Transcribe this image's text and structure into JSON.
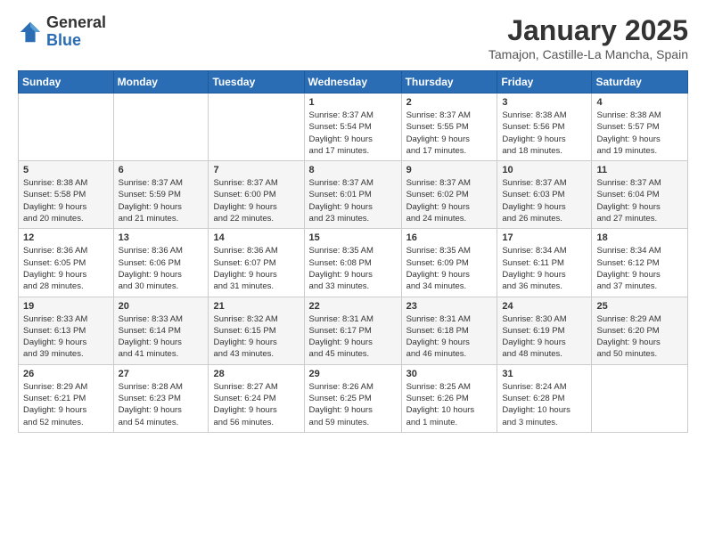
{
  "logo": {
    "general": "General",
    "blue": "Blue"
  },
  "header": {
    "month": "January 2025",
    "location": "Tamajon, Castille-La Mancha, Spain"
  },
  "weekdays": [
    "Sunday",
    "Monday",
    "Tuesday",
    "Wednesday",
    "Thursday",
    "Friday",
    "Saturday"
  ],
  "weeks": [
    [
      {
        "day": "",
        "info": ""
      },
      {
        "day": "",
        "info": ""
      },
      {
        "day": "",
        "info": ""
      },
      {
        "day": "1",
        "info": "Sunrise: 8:37 AM\nSunset: 5:54 PM\nDaylight: 9 hours\nand 17 minutes."
      },
      {
        "day": "2",
        "info": "Sunrise: 8:37 AM\nSunset: 5:55 PM\nDaylight: 9 hours\nand 17 minutes."
      },
      {
        "day": "3",
        "info": "Sunrise: 8:38 AM\nSunset: 5:56 PM\nDaylight: 9 hours\nand 18 minutes."
      },
      {
        "day": "4",
        "info": "Sunrise: 8:38 AM\nSunset: 5:57 PM\nDaylight: 9 hours\nand 19 minutes."
      }
    ],
    [
      {
        "day": "5",
        "info": "Sunrise: 8:38 AM\nSunset: 5:58 PM\nDaylight: 9 hours\nand 20 minutes."
      },
      {
        "day": "6",
        "info": "Sunrise: 8:37 AM\nSunset: 5:59 PM\nDaylight: 9 hours\nand 21 minutes."
      },
      {
        "day": "7",
        "info": "Sunrise: 8:37 AM\nSunset: 6:00 PM\nDaylight: 9 hours\nand 22 minutes."
      },
      {
        "day": "8",
        "info": "Sunrise: 8:37 AM\nSunset: 6:01 PM\nDaylight: 9 hours\nand 23 minutes."
      },
      {
        "day": "9",
        "info": "Sunrise: 8:37 AM\nSunset: 6:02 PM\nDaylight: 9 hours\nand 24 minutes."
      },
      {
        "day": "10",
        "info": "Sunrise: 8:37 AM\nSunset: 6:03 PM\nDaylight: 9 hours\nand 26 minutes."
      },
      {
        "day": "11",
        "info": "Sunrise: 8:37 AM\nSunset: 6:04 PM\nDaylight: 9 hours\nand 27 minutes."
      }
    ],
    [
      {
        "day": "12",
        "info": "Sunrise: 8:36 AM\nSunset: 6:05 PM\nDaylight: 9 hours\nand 28 minutes."
      },
      {
        "day": "13",
        "info": "Sunrise: 8:36 AM\nSunset: 6:06 PM\nDaylight: 9 hours\nand 30 minutes."
      },
      {
        "day": "14",
        "info": "Sunrise: 8:36 AM\nSunset: 6:07 PM\nDaylight: 9 hours\nand 31 minutes."
      },
      {
        "day": "15",
        "info": "Sunrise: 8:35 AM\nSunset: 6:08 PM\nDaylight: 9 hours\nand 33 minutes."
      },
      {
        "day": "16",
        "info": "Sunrise: 8:35 AM\nSunset: 6:09 PM\nDaylight: 9 hours\nand 34 minutes."
      },
      {
        "day": "17",
        "info": "Sunrise: 8:34 AM\nSunset: 6:11 PM\nDaylight: 9 hours\nand 36 minutes."
      },
      {
        "day": "18",
        "info": "Sunrise: 8:34 AM\nSunset: 6:12 PM\nDaylight: 9 hours\nand 37 minutes."
      }
    ],
    [
      {
        "day": "19",
        "info": "Sunrise: 8:33 AM\nSunset: 6:13 PM\nDaylight: 9 hours\nand 39 minutes."
      },
      {
        "day": "20",
        "info": "Sunrise: 8:33 AM\nSunset: 6:14 PM\nDaylight: 9 hours\nand 41 minutes."
      },
      {
        "day": "21",
        "info": "Sunrise: 8:32 AM\nSunset: 6:15 PM\nDaylight: 9 hours\nand 43 minutes."
      },
      {
        "day": "22",
        "info": "Sunrise: 8:31 AM\nSunset: 6:17 PM\nDaylight: 9 hours\nand 45 minutes."
      },
      {
        "day": "23",
        "info": "Sunrise: 8:31 AM\nSunset: 6:18 PM\nDaylight: 9 hours\nand 46 minutes."
      },
      {
        "day": "24",
        "info": "Sunrise: 8:30 AM\nSunset: 6:19 PM\nDaylight: 9 hours\nand 48 minutes."
      },
      {
        "day": "25",
        "info": "Sunrise: 8:29 AM\nSunset: 6:20 PM\nDaylight: 9 hours\nand 50 minutes."
      }
    ],
    [
      {
        "day": "26",
        "info": "Sunrise: 8:29 AM\nSunset: 6:21 PM\nDaylight: 9 hours\nand 52 minutes."
      },
      {
        "day": "27",
        "info": "Sunrise: 8:28 AM\nSunset: 6:23 PM\nDaylight: 9 hours\nand 54 minutes."
      },
      {
        "day": "28",
        "info": "Sunrise: 8:27 AM\nSunset: 6:24 PM\nDaylight: 9 hours\nand 56 minutes."
      },
      {
        "day": "29",
        "info": "Sunrise: 8:26 AM\nSunset: 6:25 PM\nDaylight: 9 hours\nand 59 minutes."
      },
      {
        "day": "30",
        "info": "Sunrise: 8:25 AM\nSunset: 6:26 PM\nDaylight: 10 hours\nand 1 minute."
      },
      {
        "day": "31",
        "info": "Sunrise: 8:24 AM\nSunset: 6:28 PM\nDaylight: 10 hours\nand 3 minutes."
      },
      {
        "day": "",
        "info": ""
      }
    ]
  ]
}
